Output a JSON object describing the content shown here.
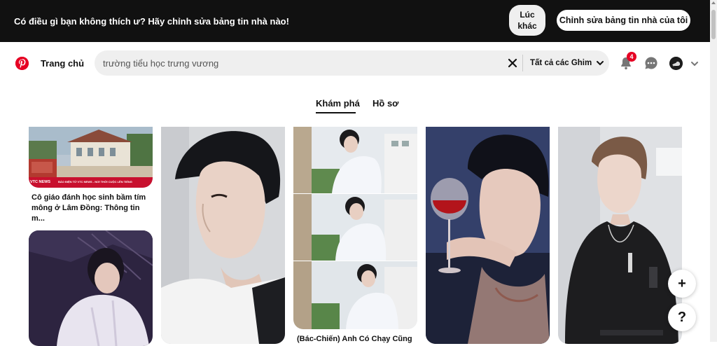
{
  "banner": {
    "message": "Có điều gì bạn không thích ư? Hãy chỉnh sửa bảng tin nhà nào!",
    "later_label": "Lúc khác",
    "edit_label": "Chỉnh sửa bảng tin nhà của tôi"
  },
  "header": {
    "home_label": "Trang chủ",
    "search_value": "trường tiểu học trưng vương",
    "filter_label": "Tất cả các Ghim",
    "notification_count": "4",
    "brand_color": "#e60023"
  },
  "tabs": [
    {
      "label": "Khám phá",
      "active": true
    },
    {
      "label": "Hồ sơ",
      "active": false
    }
  ],
  "pins": [
    {
      "caption": "Cô giáo đánh học sinh bầm tím mông ở Lâm Đồng: Thông tin m...",
      "overlay_brand": "VTC NEWS",
      "overlay_text": "BÁO ĐIỆN TỬ VTC NEWS - NƠI THỜI CUỘC LÊN TIẾNG"
    },
    {
      "caption": ""
    },
    {
      "caption": "(Bác-Chiến) Anh Có Chạy Cũng"
    },
    {
      "caption": ""
    },
    {
      "caption": ""
    },
    {
      "caption": ""
    }
  ],
  "fab": {
    "add_label": "+",
    "help_label": "?"
  },
  "icons": {
    "logo": "pinterest-logo-icon",
    "clear": "close-icon",
    "filter_chevron": "chevron-down-icon",
    "notifications": "bell-icon",
    "messages": "chat-bubble-icon",
    "account": "chevron-down-icon"
  }
}
